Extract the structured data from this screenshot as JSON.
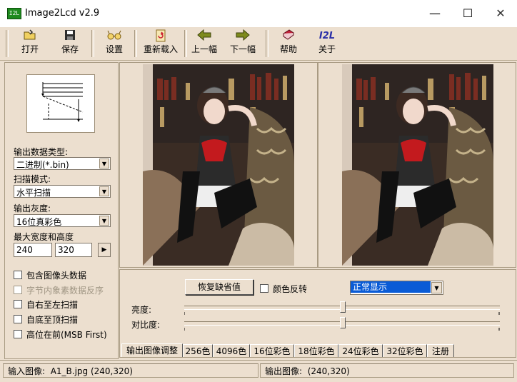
{
  "window": {
    "title": "Image2Lcd v2.9",
    "icon_text": "I2L"
  },
  "toolbar": {
    "open": "打开",
    "save": "保存",
    "settings": "设置",
    "reload": "重新载入",
    "prev": "上一幅",
    "next": "下一幅",
    "help": "帮助",
    "about": "关于",
    "about_icon_text": "I2L"
  },
  "left": {
    "output_type_label": "输出数据类型:",
    "output_type_value": "二进制(*.bin)",
    "scan_mode_label": "扫描模式:",
    "scan_mode_value": "水平扫描",
    "gray_label": "输出灰度:",
    "gray_value": "16位真彩色",
    "size_label": "最大宽度和高度",
    "max_width": "240",
    "max_height": "320",
    "checkboxes": [
      "包含图像头数据",
      "字节内象素数据反序",
      "自右至左扫描",
      "自底至顶扫描",
      "高位在前(MSB First)"
    ]
  },
  "controls": {
    "restore_default": "恢复缺省值",
    "invert_label": "颜色反转",
    "display_mode": "正常显示",
    "brightness_label": "亮度:",
    "contrast_label": "对比度:",
    "brightness_value": 50,
    "contrast_value": 50
  },
  "tabs": [
    "输出图像调整",
    "256色",
    "4096色",
    "16位彩色",
    "18位彩色",
    "24位彩色",
    "32位彩色",
    "注册"
  ],
  "status": {
    "input_label": "输入图像:",
    "input_value": "A1_B.jpg (240,320)",
    "output_label": "输出图像:",
    "output_value": "(240,320)"
  },
  "colors": {
    "panel_bg": "#ecdfcf",
    "selection": "#0a5bd6",
    "app_icon": "#1e8a1e"
  }
}
